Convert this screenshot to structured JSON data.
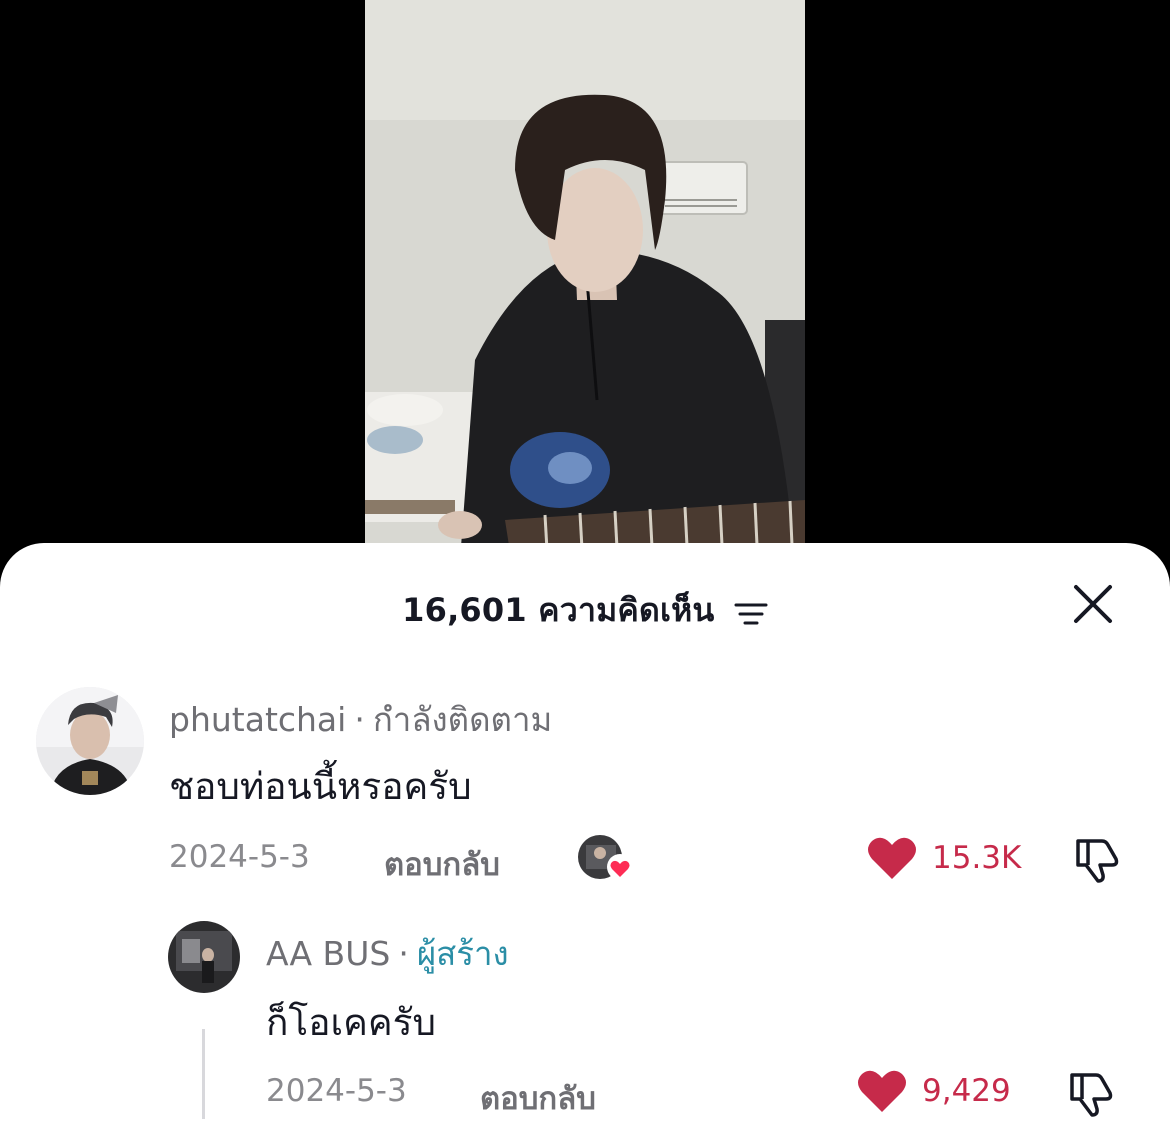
{
  "header": {
    "comment_count": "16,601",
    "comments_label": "ความคิดเห็น"
  },
  "comments": [
    {
      "username": "phutatchai",
      "separator": "·",
      "tag": "กำลังติดตาม",
      "text": "ชอบท่อนนี้หรอครับ",
      "date": "2024-5-3",
      "reply_label": "ตอบกลับ",
      "likes": "15.3K",
      "liked": true
    },
    {
      "username": "AA BUS",
      "separator": "·",
      "tag": "ผู้สร้าง",
      "text": "ก็โอเคครับ",
      "date": "2024-5-3",
      "reply_label": "ตอบกลับ",
      "likes": "9,429",
      "liked": true
    }
  ],
  "colors": {
    "like_red": "#c62a4a",
    "creator_tag": "#2b8ea6",
    "secondary_text": "#8a8a8e"
  },
  "icons": [
    "sort-icon",
    "close-icon",
    "heart-icon",
    "dislike-icon"
  ]
}
